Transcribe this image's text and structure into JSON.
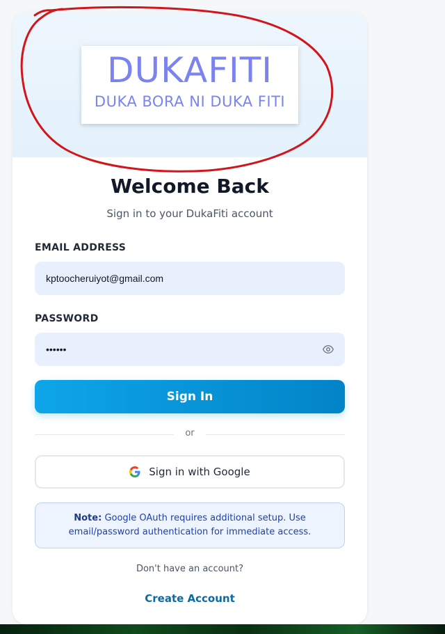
{
  "brand": {
    "logo_text": "DUKAFITI",
    "tagline": "DUKA BORA NI DUKA FITI",
    "logo_color": "#7b83ee"
  },
  "form": {
    "title": "Welcome Back",
    "subtitle": "Sign in to your DukaFiti account",
    "email_label": "EMAIL ADDRESS",
    "email_value": "kptoocheruiyot@gmail.com",
    "password_label": "PASSWORD",
    "password_value": "••••••",
    "password_toggle_icon": "eye-icon",
    "signin_label": "Sign In",
    "divider_text": "or",
    "google_label": "Sign in with Google",
    "google_icon": "google-icon"
  },
  "note": {
    "prefix": "Note:",
    "text": "Google OAuth requires additional setup. Use email/password authentication for immediate access."
  },
  "footer": {
    "prompt": "Don't have an account?",
    "create_label": "Create Account"
  },
  "colors": {
    "accent": "#0ea5e9",
    "annotation": "#d0161b",
    "link": "#0b6aa2"
  }
}
